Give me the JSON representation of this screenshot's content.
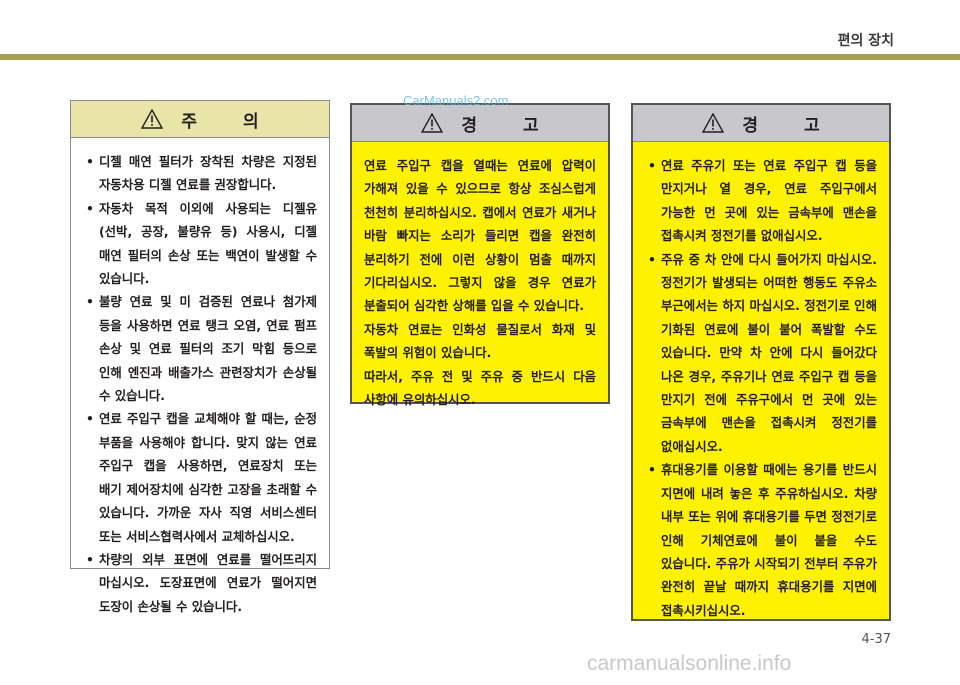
{
  "header": {
    "section_title": "편의 장치"
  },
  "caution": {
    "title": "주 의",
    "items": [
      "디젤 매연 필터가 장착된 차량은 지정된 자동차용 디젤 연료를 권장합니다.",
      "자동차 목적 이외에 사용되는 디젤유(선박, 공장, 불량유 등) 사용시, 디젤 매연 필터의 손상 또는 백연이 발생할 수 있습니다.",
      "불량 연료 및 미 검증된 연료나 첨가제 등을 사용하면 연료 탱크 오염, 연료 펌프 손상 및 연료 필터의 조기 막힘 등으로 인해 엔진과 배출가스 관련장치가 손상될 수 있습니다.",
      "연료 주입구 캡을 교체해야 할 때는, 순정 부품을 사용해야 합니다. 맞지 않는 연료 주입구 캡을 사용하면, 연료장치 또는 배기 제어장치에 심각한 고장을 초래할 수 있습니다. 가까운 자사 직영 서비스센터 또는 서비스협력사에서 교체하십시오.",
      "차량의 외부 표면에 연료를 떨어뜨리지 마십시오. 도장표면에 연료가 떨어지면 도장이 손상될 수 있습니다."
    ]
  },
  "warning1": {
    "title": "경 고",
    "paragraphs": [
      "연료 주입구 캡을 열때는 연료에 압력이 가해져 있을 수 있으므로 항상 조심스럽게 천천히 분리하십시오. 캡에서 연료가 새거나 바람 빠지는 소리가 들리면 캡을 완전히 분리하기 전에 이런 상황이 멈출 때까지 기다리십시오. 그렇지 않을 경우 연료가 분출되어 심각한 상해를 입을 수 있습니다.",
      "자동차 연료는 인화성 물질로서 화재 및 폭발의 위험이 있습니다.",
      "따라서, 주유 전 및 주유 중 반드시 다음 사항에 유의하십시오."
    ]
  },
  "warning2": {
    "title": "경 고",
    "items": [
      "연료 주유기 또는 연료 주입구 캡 등을 만지거나 열 경우, 연료 주입구에서 가능한 먼 곳에 있는 금속부에 맨손을 접촉시켜 정전기를 없애십시오.",
      "주유 중 차 안에 다시 들어가지 마십시오. 정전기가 발생되는 어떠한 행동도 주유소 부근에서는 하지 마십시오. 정전기로 인해 기화된 연료에 불이 붙어 폭발할 수도 있습니다. 만약 차 안에 다시 들어갔다 나온 경우, 주유기나 연료 주입구 캡 등을 만지기 전에 주유구에서 먼 곳에 있는 금속부에 맨손을 접촉시켜 정전기를 없애십시오.",
      "휴대용기를 이용할 때에는 용기를 반드시 지면에 내려 놓은 후 주유하십시오. 차량 내부 또는 위에 휴대용기를 두면 정전기로 인해 기체연료에 불이 붙을 수도 있습니다. 주유가 시작되기 전부터 주유가 완전히 끝날 때까지 휴대용기를 지면에 접촉시키십시오."
    ]
  },
  "footer": {
    "page_number": "4-37"
  },
  "watermarks": {
    "top": "CarManuals2.com",
    "bottom": "carmanualsonline.info"
  },
  "icons": {
    "warning_triangle": "warning-triangle-icon"
  },
  "colors": {
    "rule": "#a7a052",
    "caution_header": "#e9e5a8",
    "warning_body": "#fff200",
    "warning_header": "#c8c8cc"
  }
}
